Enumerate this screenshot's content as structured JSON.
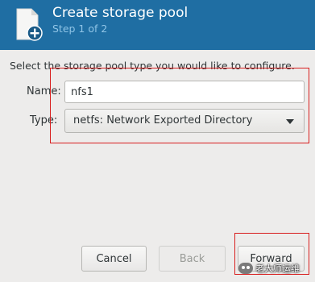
{
  "header": {
    "title": "Create storage pool",
    "subtitle": "Step 1 of 2",
    "icon": "new-document-plus-icon",
    "background": "#1f6ea3"
  },
  "form": {
    "instruction": "Select the storage pool type you would like to configure.",
    "name_label": "Name:",
    "name_value": "nfs1",
    "type_label": "Type:",
    "type_value": "netfs: Network Exported Directory"
  },
  "buttons": {
    "cancel": "Cancel",
    "back": "Back",
    "forward": "Forward",
    "back_disabled": true
  },
  "watermark": {
    "text": "老大师运维"
  },
  "highlight_color": "#d81e1e"
}
